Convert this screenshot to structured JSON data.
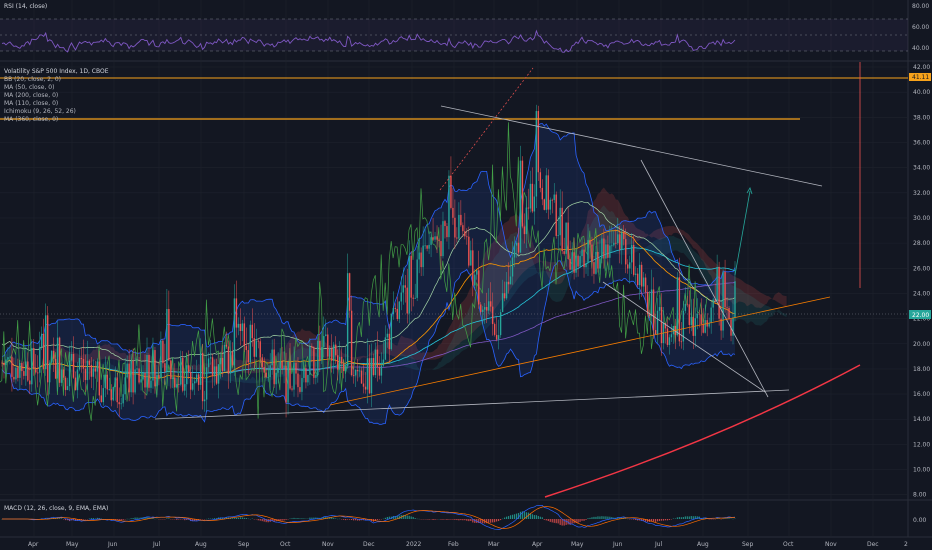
{
  "rsi_panel": {
    "title": "RSI (14, close)",
    "ticks": [
      "80.00",
      "60.00",
      "40.00"
    ]
  },
  "main_panel": {
    "legend": [
      "Volatility S&P 500 Index, 1D, CBOE",
      "BB (20, close, 2, 0)",
      "MA (50, close, 0)",
      "MA (200, close, 0)",
      "MA (110, close, 0)",
      "Ichimoku (9, 26, 52, 26)",
      "MA (360, close, 0)"
    ],
    "price_ticks": [
      "42.00",
      "40.00",
      "38.00",
      "36.00",
      "34.00",
      "32.00",
      "30.00",
      "28.00",
      "26.00",
      "24.00",
      "22.00",
      "20.00",
      "18.00",
      "16.00",
      "14.00",
      "12.00",
      "10.00",
      "8.00"
    ],
    "last_price_label": "22.00",
    "alert_price_label": "41.11"
  },
  "macd_panel": {
    "title": "MACD (12, 26, close, 9, EMA, EMA)",
    "ticks": [
      "0.00"
    ]
  },
  "time_axis": {
    "labels": [
      "Apr",
      "May",
      "Jun",
      "Jul",
      "Aug",
      "Sep",
      "Oct",
      "Nov",
      "Dec",
      "2022",
      "Feb",
      "Mar",
      "Apr",
      "May",
      "Jun",
      "Jul",
      "Aug",
      "Sep",
      "Oct",
      "Nov",
      "Dec",
      "2"
    ]
  },
  "colors": {
    "background": "#131722",
    "up": "#26a69a",
    "down": "#ef5350",
    "level_line": "#f7a21b",
    "rsi_line": "#7e57c2",
    "bollinger": "#2962ff",
    "trendline": "#b2b5be"
  },
  "chart_data": {
    "type": "candlestick",
    "title": "Volatility S&P 500 Index, 1D, CBOE",
    "ylim": [
      7,
      43
    ],
    "horizontal_levels": [
      41.11,
      38.0
    ],
    "last_price": 22.0,
    "monthly_approx_close": [
      {
        "x": "Apr",
        "y": 18.5
      },
      {
        "x": "May",
        "y": 17.8
      },
      {
        "x": "Jun",
        "y": 16.5
      },
      {
        "x": "Jul",
        "y": 18.2
      },
      {
        "x": "Aug",
        "y": 16.8
      },
      {
        "x": "Sep",
        "y": 20.5
      },
      {
        "x": "Oct",
        "y": 16.9
      },
      {
        "x": "Nov",
        "y": 19.5
      },
      {
        "x": "Dec",
        "y": 17.2
      },
      {
        "x": "2022",
        "y": 24.8
      },
      {
        "x": "Feb",
        "y": 30.2
      },
      {
        "x": "Mar",
        "y": 20.6
      },
      {
        "x": "Apr",
        "y": 33.4
      },
      {
        "x": "May",
        "y": 26.1
      },
      {
        "x": "Jun",
        "y": 28.7
      },
      {
        "x": "Jul",
        "y": 21.3
      },
      {
        "x": "Aug",
        "y": 22.0
      }
    ]
  }
}
